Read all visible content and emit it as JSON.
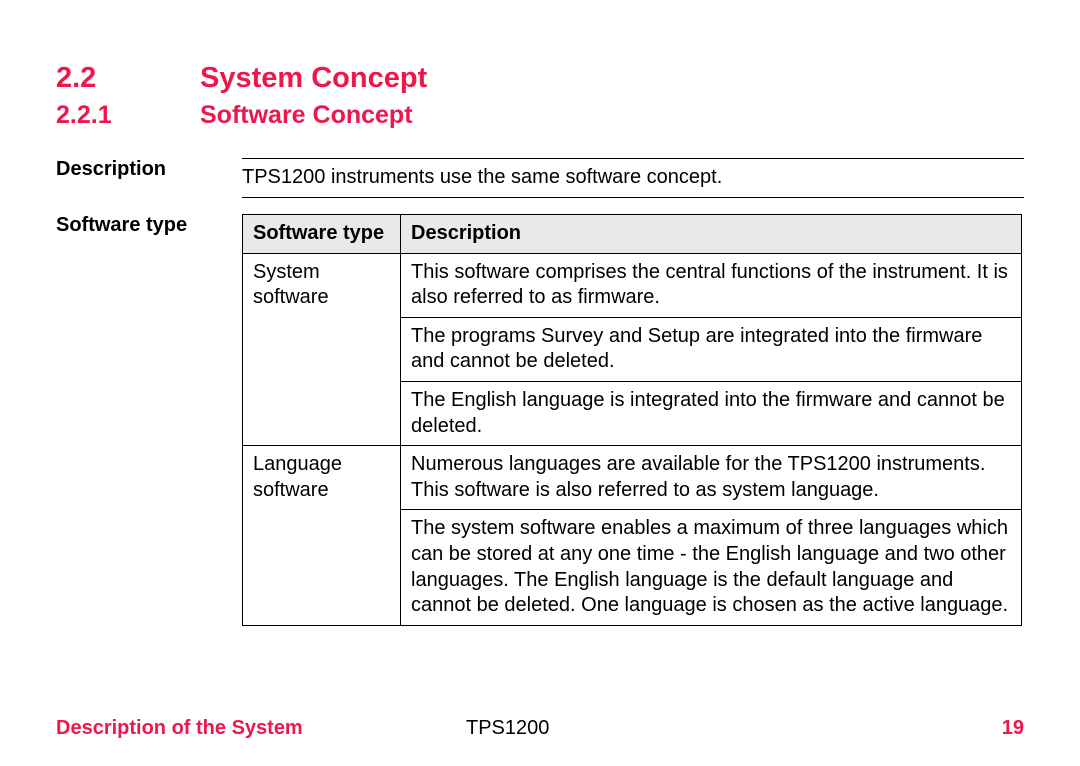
{
  "headings": {
    "h1_num": "2.2",
    "h1_text": "System Concept",
    "h2_num": "2.2.1",
    "h2_text": "Software Concept"
  },
  "description_block": {
    "label": "Description",
    "text": "TPS1200 instruments use the same software concept."
  },
  "software_type_block": {
    "label": "Software type",
    "headers": {
      "col1": "Software type",
      "col2": "Description"
    },
    "rows": {
      "r1c1": "System software",
      "r1c2": "This software comprises the central functions of the instrument. It is also referred to as firmware.",
      "r2c2": "The programs Survey and Setup are integrated into the firmware and cannot be deleted.",
      "r3c2": "The English language is integrated into the firmware and cannot be deleted.",
      "r4c1": "Language software",
      "r4c2": "Numerous languages are available for the TPS1200 instruments. This software is also referred to as system language.",
      "r5c2": "The system software enables a maximum of three languages which can be stored at any one time - the English language and two other languages. The English language is the default language and cannot be deleted. One language is chosen as the active language."
    }
  },
  "footer": {
    "left": "Description of the System",
    "mid": "TPS1200",
    "right": "19"
  }
}
